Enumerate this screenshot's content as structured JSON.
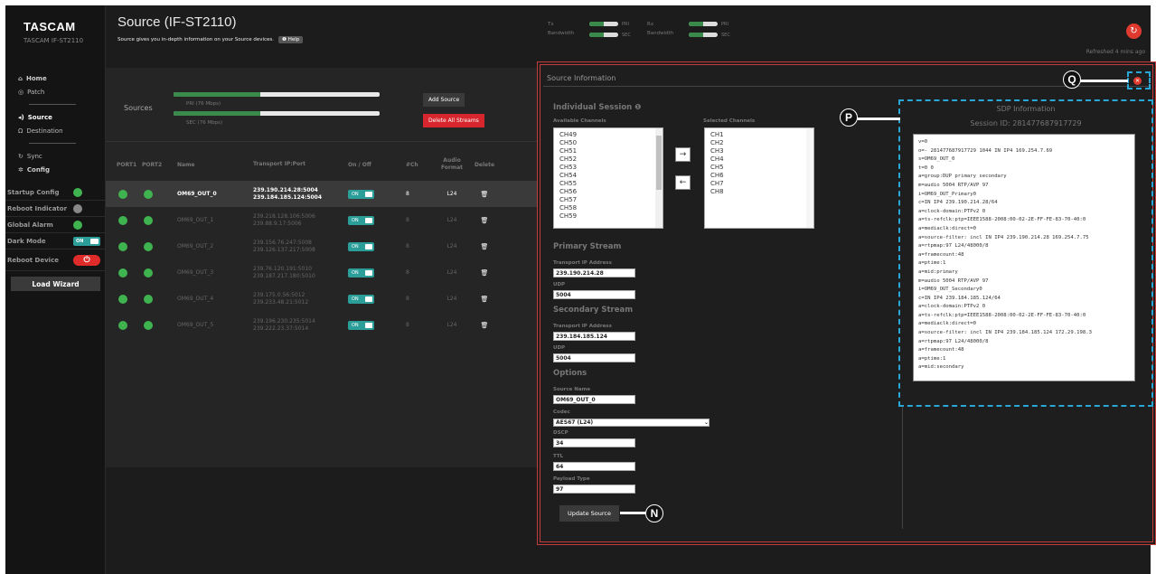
{
  "brand": {
    "logo": "TASCAM",
    "model": "TASCAM IF-ST2110"
  },
  "nav": {
    "home": "Home",
    "patch": "Patch",
    "source": "Source",
    "destination": "Destination",
    "sync": "Sync",
    "config": "Config"
  },
  "controls": {
    "startup_config": "Startup Config",
    "reboot_indicator": "Reboot Indicator",
    "global_alarm": "Global Alarm",
    "dark_mode": "Dark Mode",
    "dark_mode_state": "ON",
    "reboot_device": "Reboot Device",
    "load_wizard": "Load Wizard"
  },
  "header": {
    "title": "Source (IF-ST2110)",
    "subtitle": "Source gives you in-depth information on your Source devices.",
    "help": "Help",
    "tx_label": "Tx",
    "rx_label": "Rx",
    "bandwidth": "Bandwidth",
    "pri": "PRI",
    "sec": "SEC",
    "refreshed": "Refreshed 4 mins ago"
  },
  "sources_panel": {
    "label": "Sources",
    "pri_label": "PRI (76 Mbps)",
    "sec_label": "SEC (76 Mbps)",
    "pri_fill": 0.42,
    "sec_fill": 0.42,
    "add_source": "Add Source",
    "delete_all": "Delete All Streams"
  },
  "table": {
    "headers": [
      "PORT1",
      "PORT2",
      "Name",
      "Transport IP:Port",
      "On / Off",
      "#Ch",
      "Audio Format",
      "Delete"
    ],
    "on_label": "ON",
    "rows": [
      {
        "name": "OM69_OUT_0",
        "ip1": "239.190.214.28:5004",
        "ip2": "239.184.185.124:5004",
        "ch": "8",
        "fmt": "L24"
      },
      {
        "name": "OM69_OUT_1",
        "ip1": "239.218.128.106:5006",
        "ip2": "239.88.9.17:5006",
        "ch": "8",
        "fmt": "L24"
      },
      {
        "name": "OM69_OUT_2",
        "ip1": "239.156.76.247:5008",
        "ip2": "239.126.137.217:5008",
        "ch": "8",
        "fmt": "L24"
      },
      {
        "name": "OM69_OUT_3",
        "ip1": "239.76.120.191:5010",
        "ip2": "239.187.217.180:5010",
        "ch": "8",
        "fmt": "L24"
      },
      {
        "name": "OM69_OUT_4",
        "ip1": "239.175.0.56:5012",
        "ip2": "239.233.48.21:5012",
        "ch": "8",
        "fmt": "L24"
      },
      {
        "name": "OM69_OUT_5",
        "ip1": "239.196.230.235:5014",
        "ip2": "239.222.23.37:5014",
        "ch": "8",
        "fmt": "L24"
      }
    ]
  },
  "source_info": {
    "title": "Source Information",
    "individual_session": "Individual Session",
    "available_channels": "Available Channels",
    "selected_channels": "Selected Channels",
    "available": [
      "CH49",
      "CH50",
      "CH51",
      "CH52",
      "CH53",
      "CH54",
      "CH55",
      "CH56",
      "CH57",
      "CH58",
      "CH59"
    ],
    "selected": [
      "CH1",
      "CH2",
      "CH3",
      "CH4",
      "CH5",
      "CH6",
      "CH7",
      "CH8"
    ],
    "primary_stream": "Primary Stream",
    "secondary_stream": "Secondary Stream",
    "transport_ip": "Transport IP Address",
    "udp": "UDP",
    "primary_ip": "239.190.214.28",
    "primary_udp": "5004",
    "secondary_ip": "239.184.185.124",
    "secondary_udp": "5004",
    "options": "Options",
    "source_name_label": "Source Name",
    "source_name": "OM69_OUT_0",
    "codec_label": "Codec",
    "codec": "AES67 (L24)",
    "dscp_label": "DSCP",
    "dscp": "34",
    "ttl_label": "TTL",
    "ttl": "64",
    "payload_label": "Payload Type",
    "payload": "97",
    "update": "Update Source"
  },
  "sdp": {
    "title": "SDP Information",
    "session_id": "Session ID: 281477687917729",
    "lines": "v=0\no=- 281477687917729 1044 IN IP4 169.254.7.69\ns=OM69_OUT_0\nt=0 0\na=group:DUP primary secondary\nm=audio 5004 RTP/AVP 97\ni=OM69_OUT_Primary0\nc=IN IP4 239.190.214.28/64\na=clock-domain:PTPv2 0\na=ts-refclk:ptp=IEEE1588-2008:00-02-2E-FF-FE-83-70-40:0\na=mediaclk:direct=0\na=source-filter: incl IN IP4 239.190.214.28 169.254.7.75\na=rtpmap:97 L24/48000/8\na=framecount:48\na=ptime:1\na=mid:primary\nm=audio 5004 RTP/AVP 97\ni=OM69_OUT_Secondary0\nc=IN IP4 239.184.185.124/64\na=clock-domain:PTPv2 0\na=ts-refclk:ptp=IEEE1588-2008:00-02-2E-FF-FE-83-70-40:0\na=mediaclk:direct=0\na=source-filter: incl IN IP4 239.184.185.124 172.29.198.3\na=rtpmap:97 L24/48000/8\na=framecount:48\na=ptime:1\na=mid:secondary"
  },
  "callouts": {
    "n": "N",
    "p": "P",
    "q": "Q"
  },
  "colors": {
    "accent": "#2c9e9a",
    "danger": "#d7262d",
    "ok": "#3fb34f",
    "callout_frame": "#29a8d8"
  }
}
